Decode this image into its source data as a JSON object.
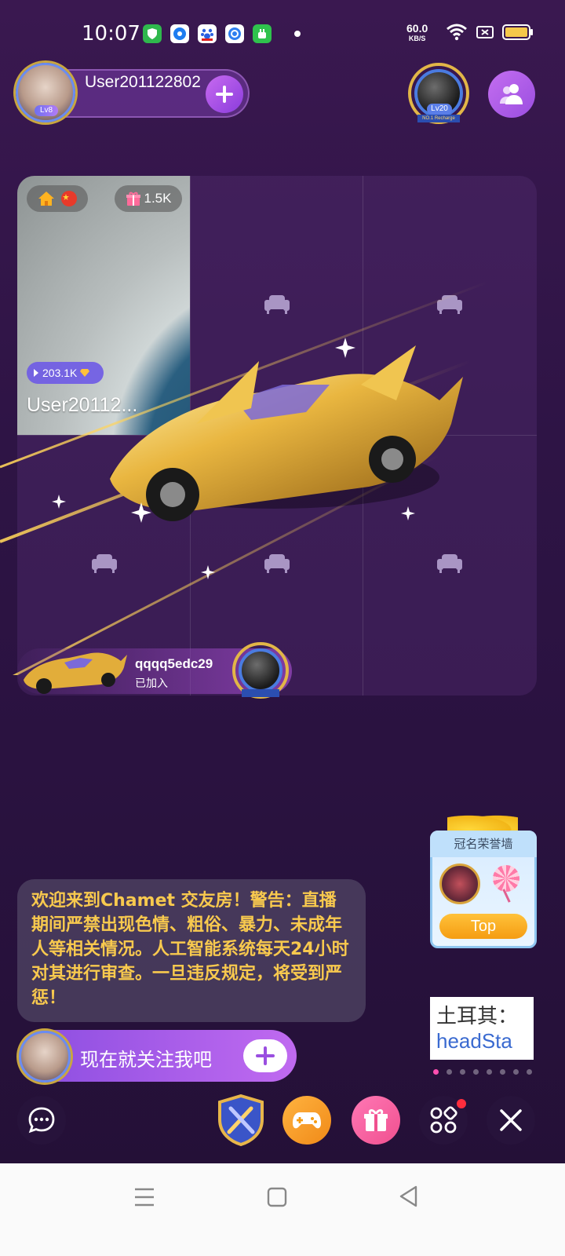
{
  "status_bar": {
    "time": "10:07",
    "net_speed_value": "60.0",
    "net_speed_unit": "KB/S",
    "icons": [
      "shield-app-icon",
      "blue-circle-app-icon",
      "baidu-paw-app-icon",
      "blue-lock-app-icon",
      "green-android-app-icon",
      "dot-icon",
      "wifi-icon",
      "battery-saver-icon",
      "battery-icon"
    ]
  },
  "host": {
    "name": "User201122802",
    "level": "Lv8"
  },
  "rank_badge": {
    "level": "Lv20",
    "ribbon": "NO.1 Recharge"
  },
  "video_cell": {
    "gift_count": "1.5K",
    "coins": "203.1K",
    "user": "User20112..."
  },
  "join": {
    "name": "qqqq5edc29",
    "status": "已加入"
  },
  "announcement": "欢迎来到Chamet 交友房！警告：直播期间严禁出现色情、粗俗、暴力、未成年人等相关情况。人工智能系统每天24小时对其进行审查。一旦违反规定，将受到严惩！",
  "follow": {
    "text": "现在就关注我吧"
  },
  "honor_wall": {
    "title": "冠名荣誉墙",
    "button": "Top"
  },
  "ad": {
    "line1": "土耳其：",
    "line2": "headSta"
  },
  "colors": {
    "background": "#2e1445",
    "announcement_text": "#f8c94e",
    "accent_purple": "#9a4ee0",
    "pager_active": "#ff4fb0"
  }
}
